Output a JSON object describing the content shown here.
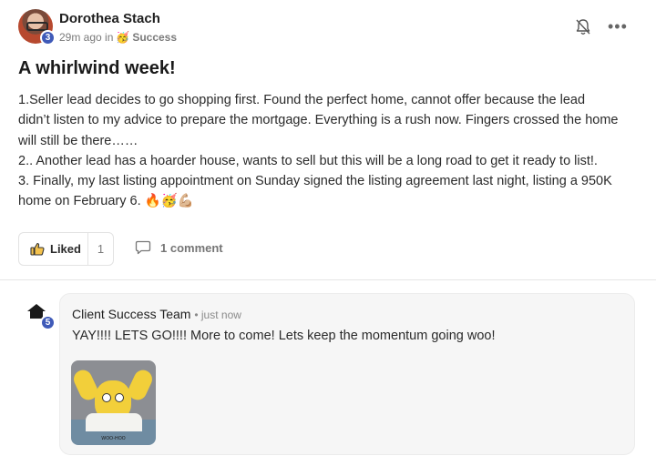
{
  "post": {
    "author": "Dorothea Stach",
    "level": "3",
    "time_prefix": "29m ago in",
    "space_emoji": "🥳",
    "space_name": "Success",
    "title": "A whirlwind week!",
    "body_lines": [
      "1.Seller lead decides to go shopping first. Found the perfect home, cannot offer because the lead",
      "didn’t listen to my advice to prepare the mortgage. Everything is a rush now. Fingers crossed the home",
      "will still be there……",
      "2.. Another lead has a hoarder house, wants to sell but this will be a long road to get it ready to list!.",
      "3. Finally, my last listing appointment on Sunday signed the listing agreement last night, listing a 950K",
      "home on February 6. 🔥🥳💪🏼"
    ],
    "like_label": "Liked",
    "like_count": "1",
    "comment_label": "1 comment",
    "icons": {
      "bell": "bell-icon",
      "more": "more-options-icon",
      "like": "thumbs-up-icon",
      "comment": "comment-icon"
    }
  },
  "comment": {
    "author": "Client Success Team",
    "time": "• just now",
    "level": "5",
    "text": "YAY!!!! LETS GO!!!! More to come! Lets keep the momentum going woo!",
    "gif_caption": "WOO-HOO"
  },
  "colors": {
    "badge": "#3f5ab8",
    "bubble": "#f6f6f6"
  }
}
